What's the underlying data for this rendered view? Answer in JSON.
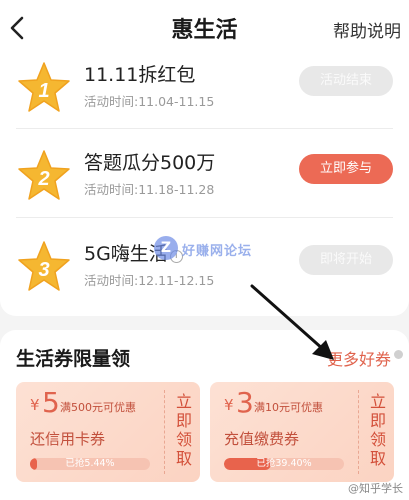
{
  "header": {
    "title": "惠生活",
    "help": "帮助说明"
  },
  "activities": [
    {
      "rank": "1",
      "name": "11.11拆红包",
      "time": "活动时间:11.04-11.15",
      "button": "活动结束"
    },
    {
      "rank": "2",
      "name": "答题瓜分500万",
      "time": "活动时间:11.18-11.28",
      "button": "立即参与"
    },
    {
      "rank": "3",
      "name": "5G嗨生活",
      "time": "活动时间:12.11-12.15",
      "button": "即将开始"
    }
  ],
  "watermark": {
    "logo": "Z",
    "text": "好赚网论坛"
  },
  "coupons_section": {
    "title": "生活券限量领",
    "more": "更多好券",
    "coupons": [
      {
        "symbol": "¥",
        "amount": "5",
        "condition": "满500元可优惠",
        "name": "还信用卡券",
        "claimed_text": "已抢5.44%",
        "claimed_pct": 5.44,
        "claim": "立即领取"
      },
      {
        "symbol": "¥",
        "amount": "3",
        "condition": "满10元可优惠",
        "name": "充值缴费券",
        "claimed_text": "已抢39.40%",
        "claimed_pct": 39.4,
        "claim": "立即领取"
      }
    ]
  },
  "footer_watermark": "@知乎学长",
  "colors": {
    "accent": "#ec6a55",
    "star": "#f5b731",
    "coupon_bg": "#fde1d4"
  }
}
